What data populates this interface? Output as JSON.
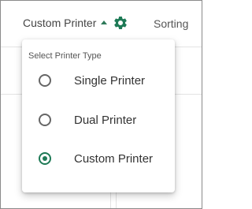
{
  "toolbar": {
    "printer_select_label": "Custom Printer",
    "sorting_label": "Sorting",
    "icons": [
      "caret-up-icon",
      "gear-icon"
    ]
  },
  "menu": {
    "header": "Select Printer Type",
    "options": [
      {
        "label": "Single Printer",
        "selected": false
      },
      {
        "label": "Dual Printer",
        "selected": false
      },
      {
        "label": "Custom Printer",
        "selected": true
      }
    ]
  },
  "colors": {
    "accent": "#1e7a56",
    "text": "#333333",
    "radio_unselected": "#666666"
  }
}
